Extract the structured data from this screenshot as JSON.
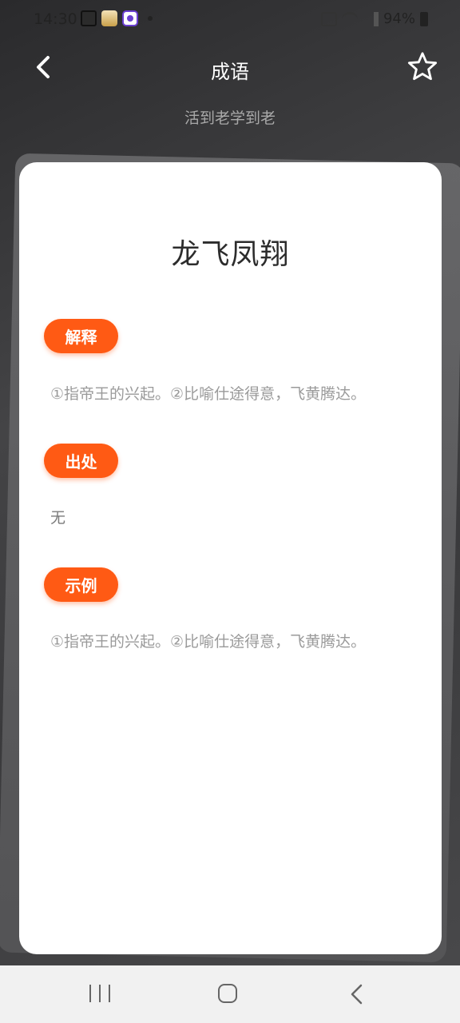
{
  "status_bar": {
    "time": "14:30",
    "battery": "94%"
  },
  "header": {
    "title": "成语",
    "subtitle": "活到老学到老"
  },
  "card": {
    "idiom": "龙飞凤翔",
    "sections": [
      {
        "label": "解释",
        "text": "①指帝王的兴起。②比喻仕途得意，飞黄腾达。"
      },
      {
        "label": "出处",
        "text": "无"
      },
      {
        "label": "示例",
        "text": "①指帝王的兴起。②比喻仕途得意，飞黄腾达。"
      }
    ]
  },
  "colors": {
    "accent": "#ff5a14",
    "card_bg": "#ffffff",
    "text_muted": "#9a9a9a"
  },
  "icons": {
    "back": "chevron-left-icon",
    "favorite": "star-outline-icon",
    "nav_recents": "recents-icon",
    "nav_home": "home-icon",
    "nav_back": "back-icon"
  }
}
